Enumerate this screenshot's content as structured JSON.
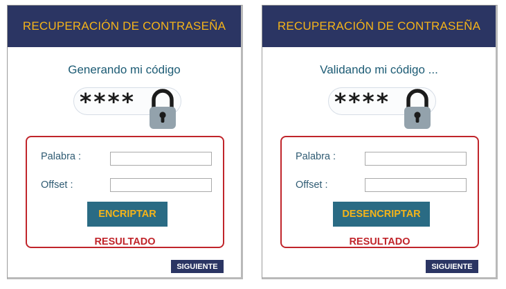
{
  "panels": [
    {
      "header_title": "RECUPERACIÓN DE CONTRASEÑA",
      "status_text": "Generando mi código",
      "code_mask": "****",
      "word_label": "Palabra :",
      "word_value": "",
      "offset_label": "Offset :",
      "offset_value": "",
      "action_label": "ENCRIPTAR",
      "result_label": "RESULTADO",
      "next_label": "SIGUIENTE"
    },
    {
      "header_title": "RECUPERACIÓN DE CONTRASEÑA",
      "status_text": "Validando mi código ...",
      "code_mask": "****",
      "word_label": "Palabra :",
      "word_value": "",
      "offset_label": "Offset :",
      "offset_value": "",
      "action_label": "DESENCRIPTAR",
      "result_label": "RESULTADO",
      "next_label": "SIGUIENTE"
    }
  ],
  "icons": {
    "lock": "lock-icon"
  },
  "colors": {
    "header_bg": "#2b3563",
    "header_text": "#f5b419",
    "accent_red": "#c0242a",
    "button_bg": "#2a6b84",
    "status_text": "#1c5b74"
  }
}
